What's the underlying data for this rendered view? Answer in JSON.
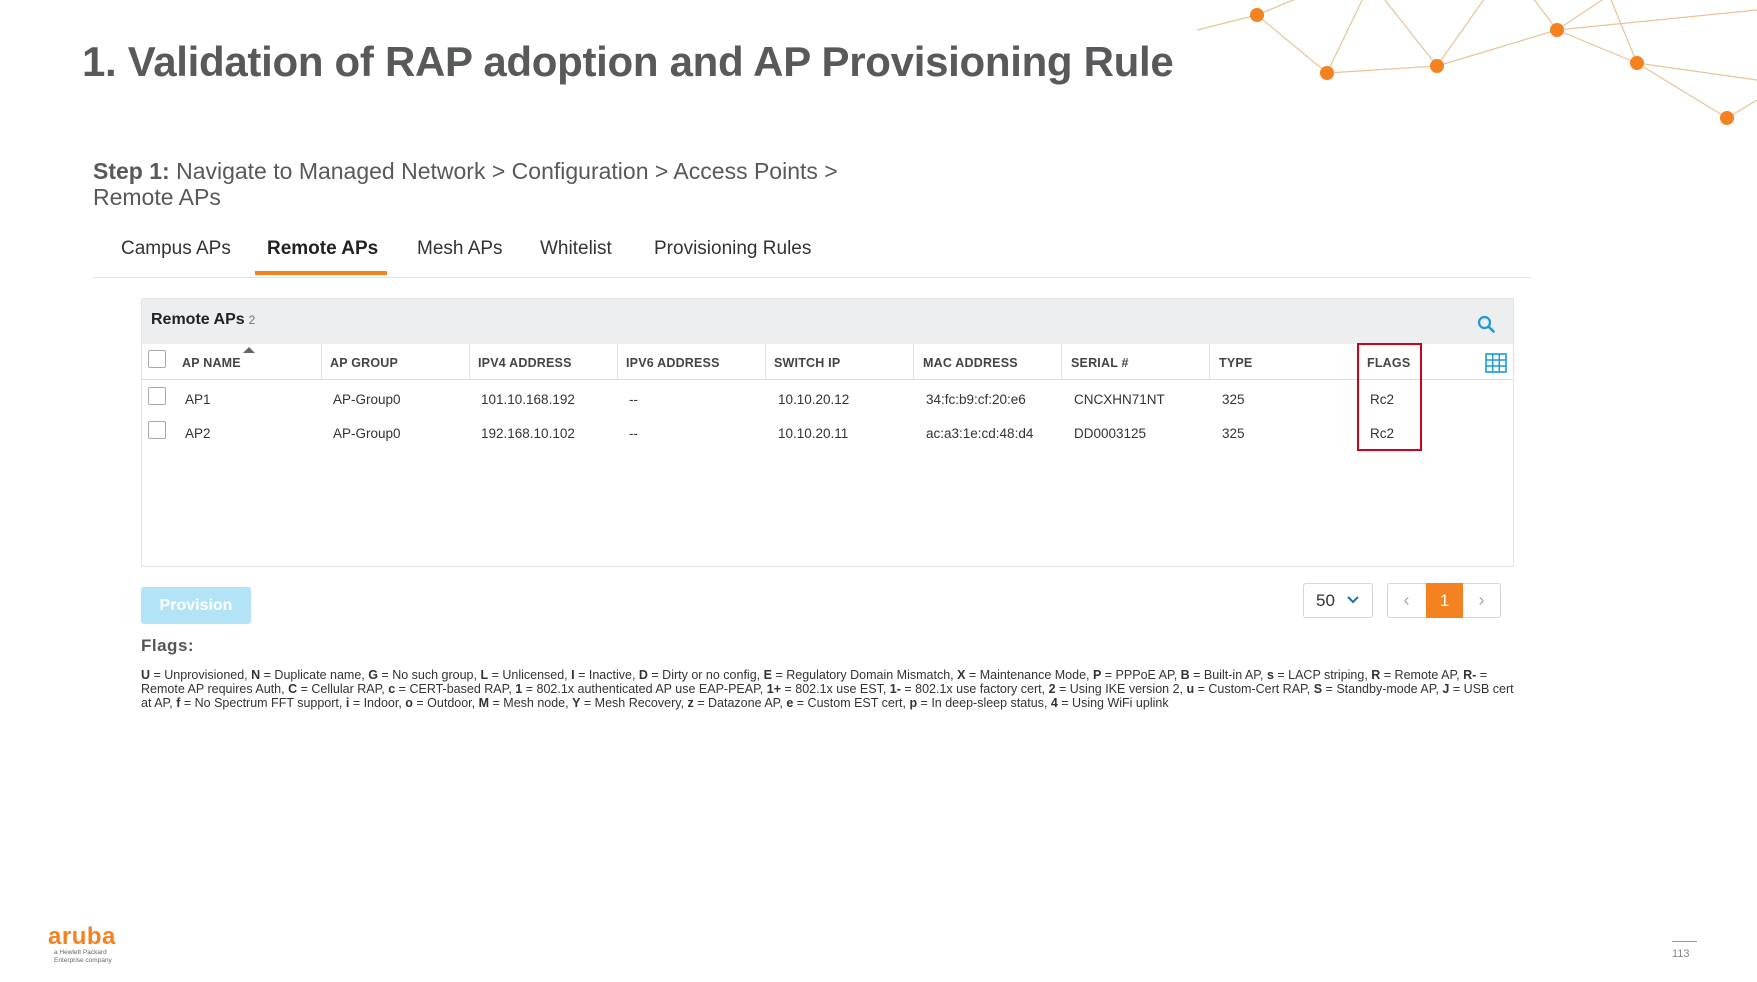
{
  "slide": {
    "title": "1. Validation of RAP adoption and AP Provisioning Rule",
    "step_label": "Step 1:",
    "step_text": " Navigate to Managed Network > Configuration > Access Points > Remote APs",
    "page_number": "113"
  },
  "tabs": [
    {
      "label": "Campus APs",
      "active": false
    },
    {
      "label": "Remote APs",
      "active": true
    },
    {
      "label": "Mesh APs",
      "active": false
    },
    {
      "label": "Whitelist",
      "active": false
    },
    {
      "label": "Provisioning Rules",
      "active": false
    }
  ],
  "panel": {
    "title": "Remote APs",
    "count": "2",
    "columns": [
      "AP NAME",
      "AP GROUP",
      "IPV4 ADDRESS",
      "IPV6 ADDRESS",
      "SWITCH IP",
      "MAC ADDRESS",
      "SERIAL #",
      "TYPE",
      "FLAGS"
    ],
    "rows": [
      [
        "AP1",
        "AP-Group0",
        "101.10.168.192",
        "--",
        "10.10.20.12",
        "34:fc:b9:cf:20:e6",
        "CNCXHN71NT",
        "325",
        "Rc2"
      ],
      [
        "AP2",
        "AP-Group0",
        "192.168.10.102",
        "--",
        "10.10.20.11",
        "ac:a3:1e:cd:48:d4",
        "DD0003125",
        "325",
        "Rc2"
      ]
    ]
  },
  "actions": {
    "provision_label": "Provision"
  },
  "pagination": {
    "page_size": "50",
    "current_page": "1",
    "prev_glyph": "‹",
    "next_glyph": "›"
  },
  "flags": {
    "heading": "Flags:",
    "legend": [
      {
        "k": "U",
        "v": " = Unprovisioned, "
      },
      {
        "k": "N",
        "v": " = Duplicate name, "
      },
      {
        "k": "G",
        "v": " = No such group, "
      },
      {
        "k": "L",
        "v": " = Unlicensed, "
      },
      {
        "k": "I",
        "v": " = Inactive, "
      },
      {
        "k": "D",
        "v": " = Dirty or no config, "
      },
      {
        "k": "E",
        "v": " = Regulatory Domain Mismatch, "
      },
      {
        "k": "X",
        "v": " = Maintenance Mode, "
      },
      {
        "k": "P",
        "v": " = PPPoE AP, "
      },
      {
        "k": "B",
        "v": " = Built-in AP, "
      },
      {
        "k": "s",
        "v": " = LACP striping, "
      },
      {
        "k": "R",
        "v": " = Remote AP, "
      },
      {
        "k": "R-",
        "v": " = Remote AP requires Auth, "
      },
      {
        "k": "C",
        "v": " = Cellular RAP, "
      },
      {
        "k": "c",
        "v": " = CERT-based RAP, "
      },
      {
        "k": "1",
        "v": " = 802.1x authenticated AP use EAP-PEAP, "
      },
      {
        "k": "1+",
        "v": " = 802.1x use EST, "
      },
      {
        "k": "1-",
        "v": " = 802.1x use factory cert, "
      },
      {
        "k": "2",
        "v": " = Using IKE version 2, "
      },
      {
        "k": "u",
        "v": " = Custom-Cert RAP, "
      },
      {
        "k": "S",
        "v": " = Standby-mode AP, "
      },
      {
        "k": "J",
        "v": " = USB cert at AP, "
      },
      {
        "k": "f",
        "v": " = No Spectrum FFT support, "
      },
      {
        "k": "i",
        "v": " = Indoor, "
      },
      {
        "k": "o",
        "v": " = Outdoor, "
      },
      {
        "k": "M",
        "v": " = Mesh node, "
      },
      {
        "k": "Y",
        "v": " = Mesh Recovery, "
      },
      {
        "k": "z",
        "v": " = Datazone AP, "
      },
      {
        "k": "e",
        "v": " = Custom EST cert, "
      },
      {
        "k": "p",
        "v": " = In deep-sleep status, "
      },
      {
        "k": "4",
        "v": " = Using WiFi uplink"
      }
    ]
  },
  "branding": {
    "logo_text": "aruba",
    "logo_sub": "a Hewlett Packard Enterprise company",
    "accent_color": "#f58220",
    "highlight_color": "#d0021b"
  }
}
